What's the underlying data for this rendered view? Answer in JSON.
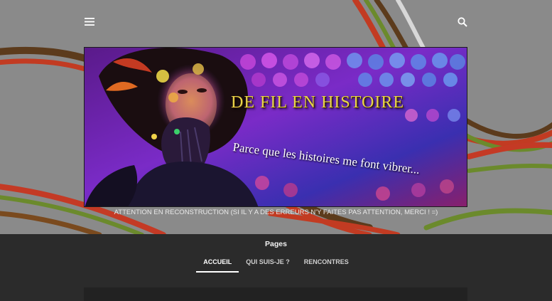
{
  "header": {
    "menu_icon": "hamburger-menu-icon",
    "search_icon": "search-icon"
  },
  "banner": {
    "title": "DE FIL EN HISTOIRE",
    "subtitle": "Parce que les histoires me font vibrer..."
  },
  "notice": "ATTENTION EN RECONSTRUCTION (SI IL Y A DES ERREURS N'Y FAITES PAS ATTENTION, MERCI ! =)",
  "pages": {
    "title": "Pages",
    "tabs": [
      {
        "label": "ACCUEIL",
        "active": true
      },
      {
        "label": "QUI SUIS-JE ?",
        "active": false
      },
      {
        "label": "RENCONTRES",
        "active": false
      }
    ]
  },
  "colors": {
    "page_bg": "#8a8a8a",
    "pages_bar_bg": "#2b2b2b",
    "title_gold": "#e8d44a"
  }
}
